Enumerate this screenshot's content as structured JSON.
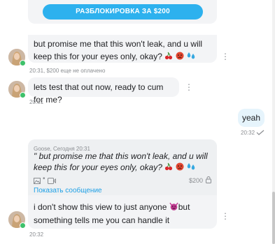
{
  "paywall": {
    "unlock_label": "РАЗБЛОКИРОВКА ЗА $200"
  },
  "messages": [
    {
      "text": "but promise me that this won't leak, and u will keep this for your eyes only, okay?",
      "time": "20:31",
      "price_status": "$200 еще не оплачено"
    },
    {
      "text": "lets test that out now, ready to cum for me?",
      "time": "20:31"
    },
    {
      "text": "yeah",
      "time": "20:32"
    },
    {
      "quote_header": "Goose, Сегодня 20:31",
      "quote_text": "\" but promise me that this won't leak, and u will keep this for your eyes only, okay?",
      "quote_price": "$200",
      "quote_link": "Показать сообщение",
      "text": "i don't show this view to just anyone",
      "text_tail": "but something tells me you can handle it",
      "time": "20:32"
    }
  ],
  "icons": {
    "emoji_1": "cherries-icon",
    "emoji_2": "angry-face-icon",
    "emoji_3": "sweat-droplets-icon",
    "emoji_4": "smiling-devil-icon",
    "read_status": "read-check-icon",
    "media_image": "image-icon",
    "media_video": "video-icon",
    "lock": "lock-icon",
    "more": "more-dots-icon"
  },
  "colors": {
    "accent": "#2db1ee",
    "link": "#1ea0e6",
    "bubble_bg": "#f3f4f6",
    "outgoing_bg": "#e6f4fc",
    "online": "#3ec16a"
  }
}
